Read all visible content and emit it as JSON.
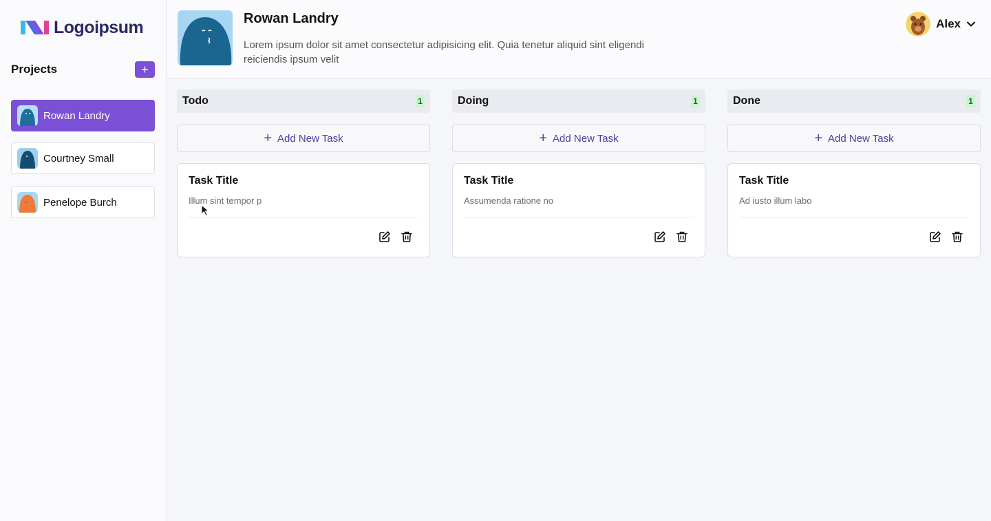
{
  "brand": {
    "name": "Logoipsum"
  },
  "sidebar": {
    "projects_title": "Projects",
    "add_label": "+",
    "items": [
      {
        "label": "Rowan Landry",
        "active": true,
        "avatar_color": "#1f6f9a"
      },
      {
        "label": "Courtney Small",
        "active": false,
        "avatar_color": "#154d72"
      },
      {
        "label": "Penelope Burch",
        "active": false,
        "avatar_color": "#f07a3a"
      }
    ]
  },
  "header": {
    "title": "Rowan Landry",
    "description": "Lorem ipsum dolor sit amet consectetur adipisicing elit. Quia tenetur aliquid sint eligendi reiciendis ipsum velit",
    "user_name": "Alex"
  },
  "board": {
    "add_task_label": "Add New Task",
    "columns": [
      {
        "title": "Todo",
        "count": "1",
        "tasks": [
          {
            "title": "Task Title",
            "description": "Illum sint tempor p"
          }
        ]
      },
      {
        "title": "Doing",
        "count": "1",
        "tasks": [
          {
            "title": "Task Title",
            "description": "Assumenda ratione no"
          }
        ]
      },
      {
        "title": "Done",
        "count": "1",
        "tasks": [
          {
            "title": "Task Title",
            "description": "Ad iusto illum labo"
          }
        ]
      }
    ]
  },
  "colors": {
    "accent": "#7b4fd6",
    "count_badge_bg": "#cdf3d3",
    "add_task_text": "#4a3d9c"
  },
  "icons": [
    "plus-icon",
    "chevron-down-icon",
    "edit-icon",
    "trash-icon"
  ]
}
